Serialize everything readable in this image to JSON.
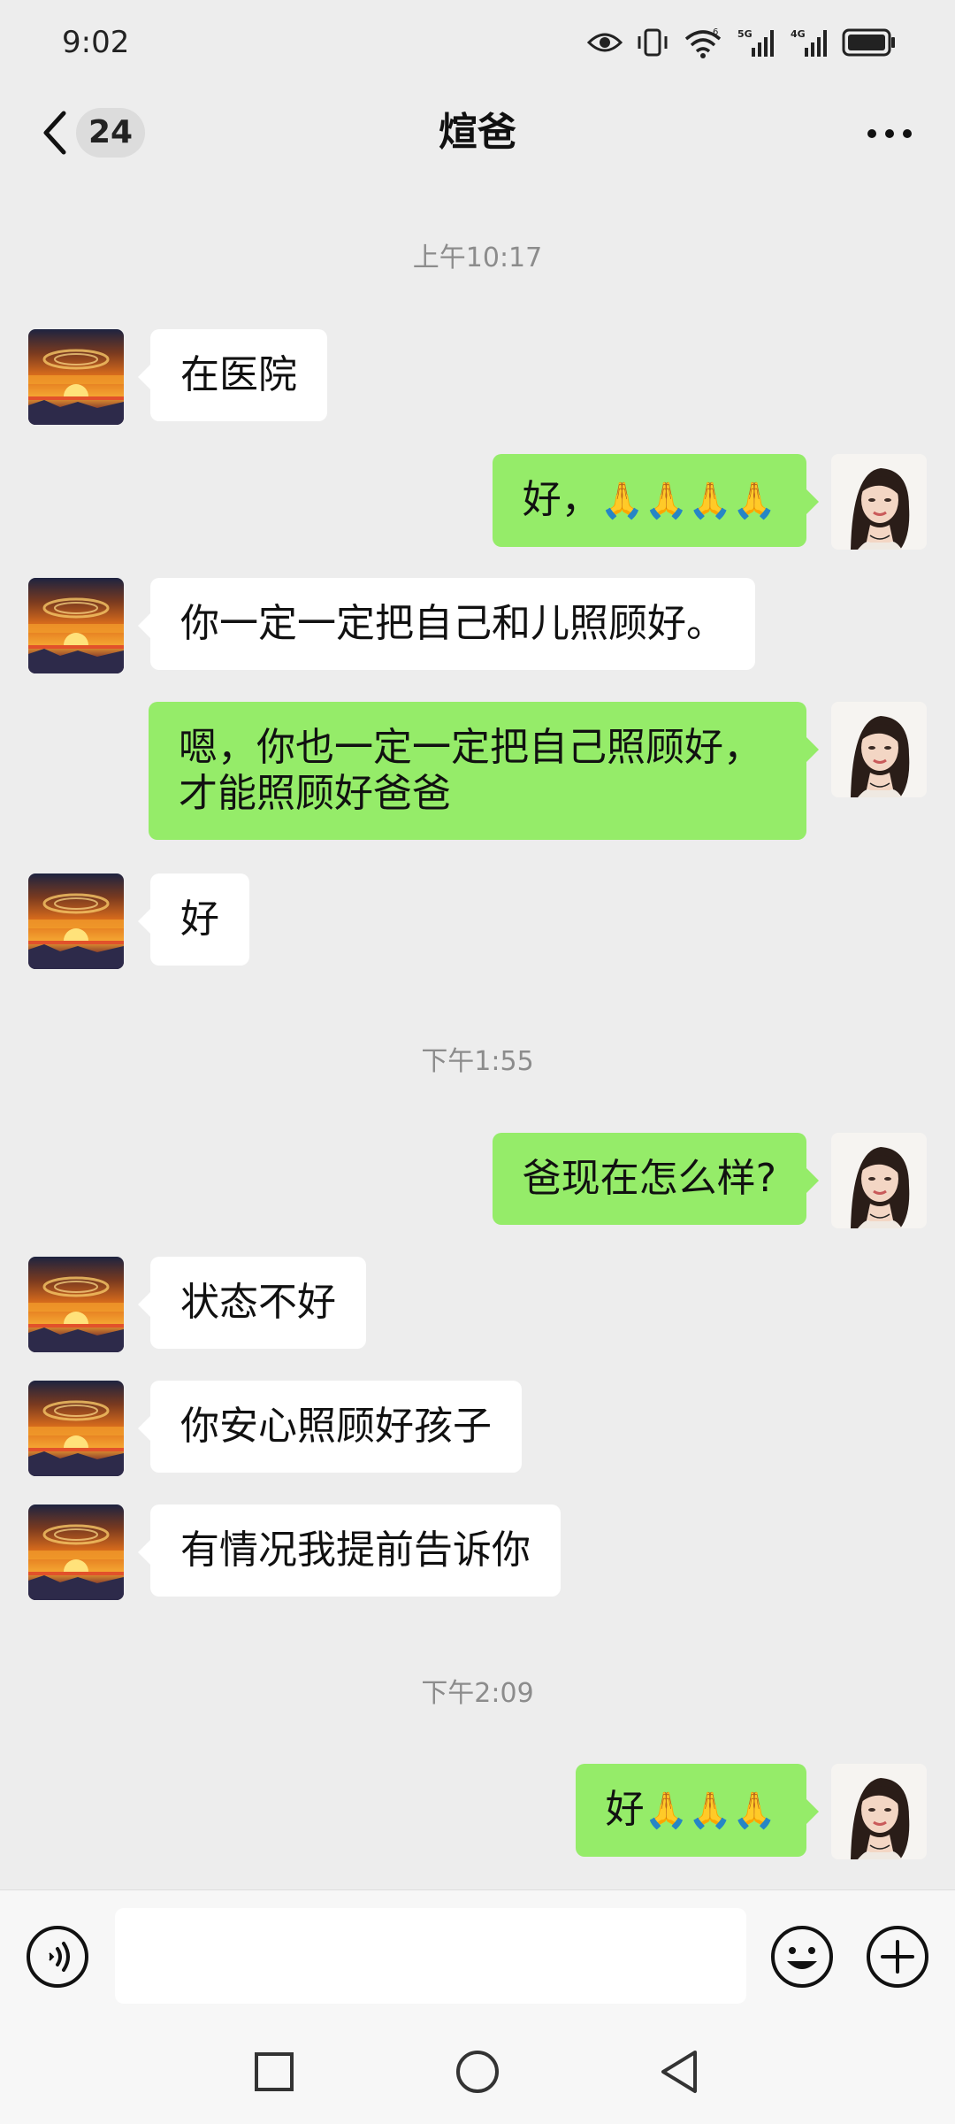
{
  "status_bar": {
    "time": "9:02",
    "net_5g": "5G",
    "net_4g": "4G",
    "wifi_gen": "6"
  },
  "header": {
    "unread_count": "24",
    "title": "煊爸"
  },
  "timestamps": {
    "t1": "上午10:17",
    "t2": "下午1:55",
    "t3": "下午2:09"
  },
  "messages": [
    {
      "side": "left",
      "text": "在医院"
    },
    {
      "side": "right",
      "text": "好，",
      "emoji": "🙏🙏🙏🙏"
    },
    {
      "side": "left",
      "text": "你一定一定把自己和儿照顾好。"
    },
    {
      "side": "right",
      "text_line1": "嗯，你也一定一定把自己照顾好，",
      "text_line2": "才能照顾好爸爸"
    },
    {
      "side": "left",
      "text": "好"
    },
    {
      "side": "right",
      "text": "爸现在怎么样?"
    },
    {
      "side": "left",
      "text": "状态不好"
    },
    {
      "side": "left",
      "text": "你安心照顾好孩子"
    },
    {
      "side": "left",
      "text": "有情况我提前告诉你"
    },
    {
      "side": "right",
      "text": "好",
      "emoji": "🙏🙏🙏"
    }
  ],
  "input": {
    "value": "",
    "placeholder": ""
  },
  "icons": {
    "back": "chevron-left-icon",
    "more": "more-dots-icon",
    "voice": "voice-icon",
    "emoji": "emoji-icon",
    "plus": "plus-icon",
    "nav_recent": "square-icon",
    "nav_home": "circle-icon",
    "nav_back": "triangle-back-icon"
  },
  "colors": {
    "bg": "#ededed",
    "bubble_out": "#95ec69",
    "bubble_in": "#ffffff",
    "timestamp": "#8c8c8c"
  }
}
